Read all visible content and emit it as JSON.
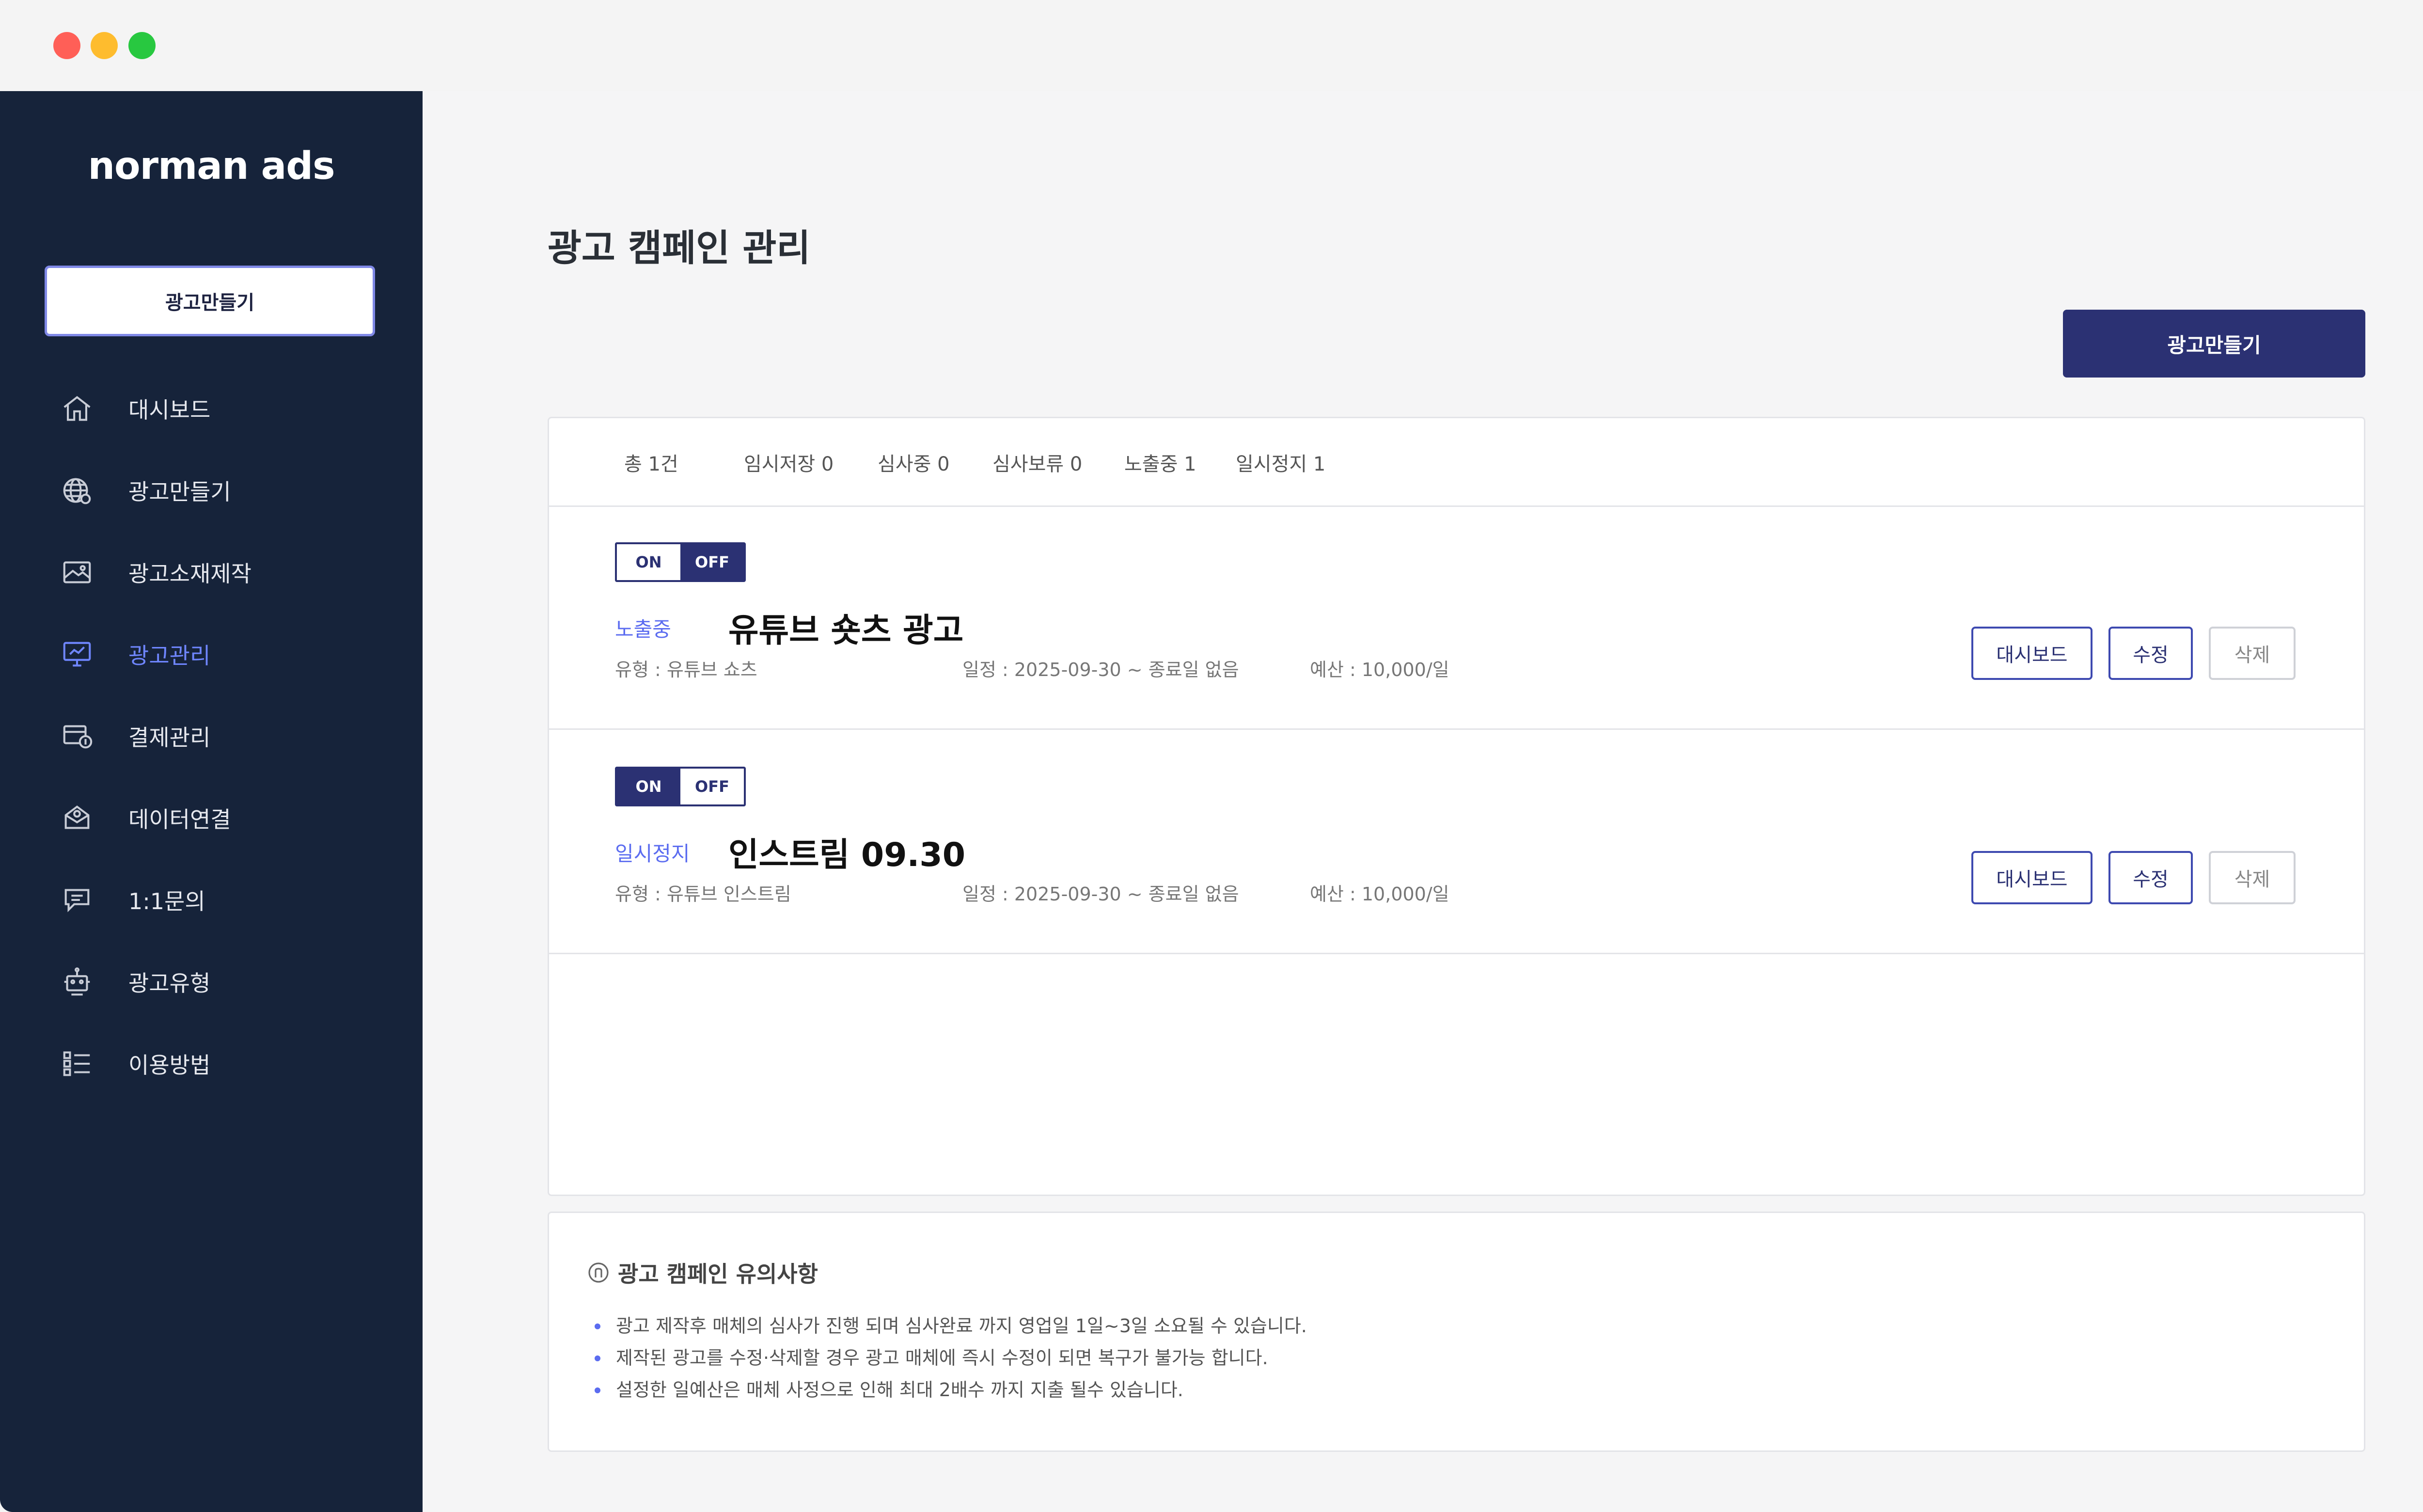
{
  "window": {
    "controls": {
      "close_color": "#ff5f57",
      "minimize_color": "#febc2e",
      "zoom_color": "#28c840"
    }
  },
  "sidebar": {
    "logo": "norman ads",
    "create_button": "광고만들기",
    "items": [
      {
        "label": "대시보드",
        "icon": "home-icon",
        "active": false
      },
      {
        "label": "광고만들기",
        "icon": "globe-icon",
        "active": false
      },
      {
        "label": "광고소재제작",
        "icon": "image-icon",
        "active": false
      },
      {
        "label": "광고관리",
        "icon": "monitor-icon",
        "active": true
      },
      {
        "label": "결제관리",
        "icon": "billing-icon",
        "active": false
      },
      {
        "label": "데이터연결",
        "icon": "data-link-icon",
        "active": false
      },
      {
        "label": "1:1문의",
        "icon": "chat-icon",
        "active": false
      },
      {
        "label": "광고유형",
        "icon": "robot-icon",
        "active": false
      },
      {
        "label": "이용방법",
        "icon": "list-icon",
        "active": false
      }
    ]
  },
  "main": {
    "title": "광고 캠페인 관리",
    "create_button": "광고만들기",
    "stats": [
      "총 1건",
      "임시저장 0",
      "심사중 0",
      "심사보류 0",
      "노출중 1",
      "일시정지 1"
    ],
    "campaigns": [
      {
        "toggle_on": "ON",
        "toggle_off": "OFF",
        "state": "on",
        "status": "노출중",
        "title": "유튜브 숏츠 광고",
        "type": "유형 : 유튜브 쇼츠",
        "schedule": "일정 : 2025-09-30 ~ 종료일 없음",
        "budget": "예산 : 10,000/일",
        "buttons": {
          "dashboard": "대시보드",
          "edit": "수정",
          "delete": "삭제"
        }
      },
      {
        "toggle_on": "ON",
        "toggle_off": "OFF",
        "state": "off",
        "status": "일시정지",
        "title": "인스트림 09.30",
        "type": "유형 : 유튜브 인스트림",
        "schedule": "일정 : 2025-09-30 ~ 종료일 없음",
        "budget": "예산 : 10,000/일",
        "buttons": {
          "dashboard": "대시보드",
          "edit": "수정",
          "delete": "삭제"
        }
      }
    ]
  },
  "notice": {
    "title": "광고 캠페인 유의사항",
    "items": [
      "광고 제작후 매체의 심사가 진행 되며 심사완료 까지 영업일 1일~3일 소요될 수 있습니다.",
      "제작된 광고를 수정·삭제할 경우 광고 매체에 즉시 수정이 되면 복구가 불가능 합니다.",
      "설정한 일예산은 매체 사정으로 인해 최대 2배수 까지 지출 될수 있습니다."
    ]
  },
  "colors": {
    "sidebar_bg": "#16233a",
    "accent": "#2b3173",
    "active": "#6f86ff",
    "status": "#5b6cf0"
  }
}
